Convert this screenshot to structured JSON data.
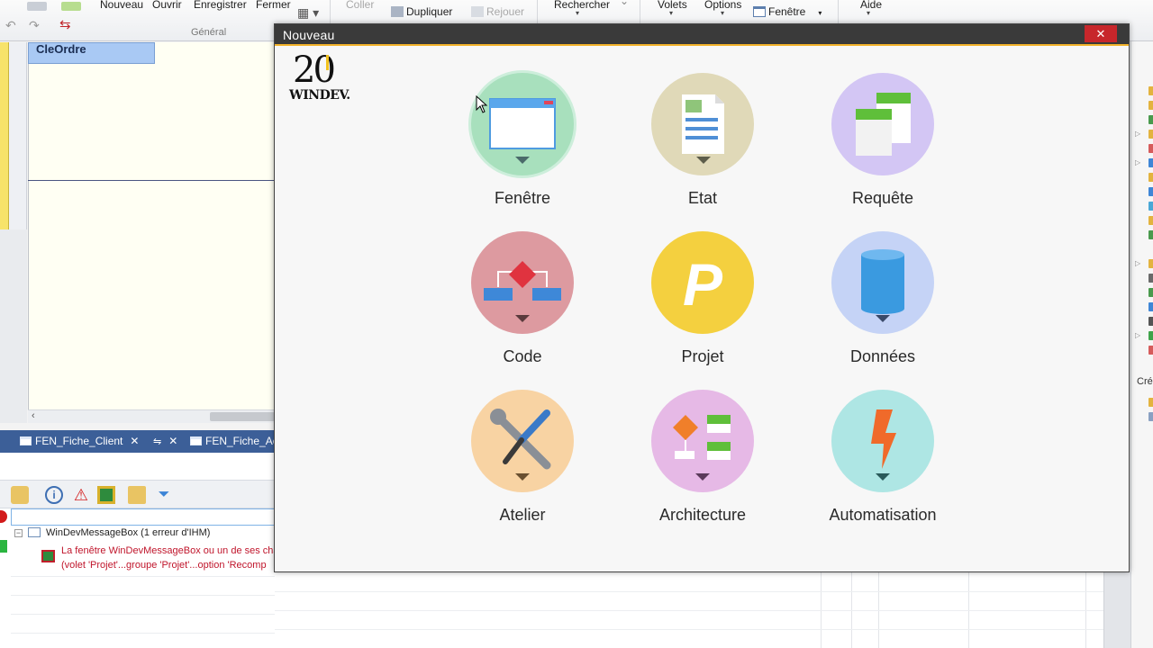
{
  "ribbon": {
    "nouveau": "Nouveau",
    "ouvrir": "Ouvrir",
    "enregistrer": "Enregistrer",
    "fermer": "Fermer",
    "coller": "Coller",
    "dupliquer": "Dupliquer",
    "rejouer": "Rejouer",
    "general": "Général",
    "rechercher": "Rechercher",
    "volets": "Volets",
    "options": "Options",
    "fenetre": "Fenêtre",
    "aide": "Aide"
  },
  "editor": {
    "field_label": "CleOrdre"
  },
  "doc_tabs": [
    {
      "label": "FEN_Fiche_Client"
    },
    {
      "label": "FEN_Fiche_Ac"
    }
  ],
  "errors": {
    "group_label": "WinDevMessageBox (1 erreur d'IHM)",
    "line1": "La fenêtre WinDevMessageBox ou un de ses cha",
    "line2": "(volet 'Projet'...groupe 'Projet'...option 'Recomp"
  },
  "right_panel": {
    "label": "Cré"
  },
  "dialog": {
    "title": "Nouveau",
    "close_glyph": "✕",
    "logo_number": "20",
    "logo_brand": "WINDEV.",
    "tiles": [
      {
        "label": "Fenêtre",
        "icon": "window-icon",
        "color": "#a8e0bd"
      },
      {
        "label": "Etat",
        "icon": "report-icon",
        "color": "#e0d9b8"
      },
      {
        "label": "Requête",
        "icon": "query-icon",
        "color": "#d3c6f4"
      },
      {
        "label": "Code",
        "icon": "code-icon",
        "color": "#dd9aa0"
      },
      {
        "label": "Projet",
        "icon": "project-icon",
        "color": "#f4d03f"
      },
      {
        "label": "Données",
        "icon": "database-icon",
        "color": "#c5d3f6"
      },
      {
        "label": "Atelier",
        "icon": "tools-icon",
        "color": "#f8d3a3"
      },
      {
        "label": "Architecture",
        "icon": "architecture-icon",
        "color": "#e6b9e6"
      },
      {
        "label": "Automatisation",
        "icon": "automation-icon",
        "color": "#aee6e4"
      }
    ]
  }
}
